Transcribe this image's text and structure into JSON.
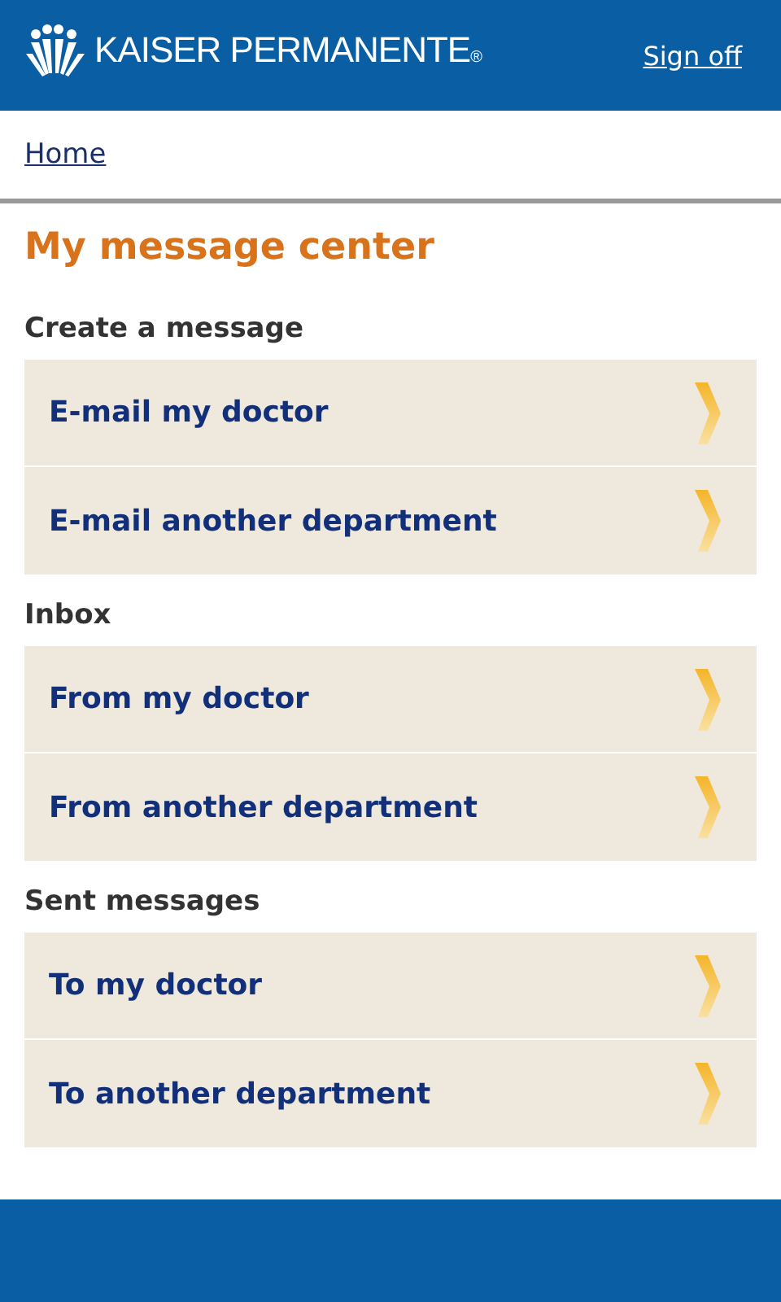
{
  "header": {
    "logo_text": "KAISER PERMANENTE",
    "logo_mark": "®",
    "sign_off": "Sign off"
  },
  "breadcrumb": "Home",
  "title": "My message center",
  "sections": [
    {
      "heading": "Create a message",
      "items": [
        "E-mail my doctor",
        "E-mail another department"
      ]
    },
    {
      "heading": "Inbox",
      "items": [
        "From my doctor",
        "From another department"
      ]
    },
    {
      "heading": "Sent messages",
      "items": [
        "To my doctor",
        "To another department"
      ]
    }
  ]
}
